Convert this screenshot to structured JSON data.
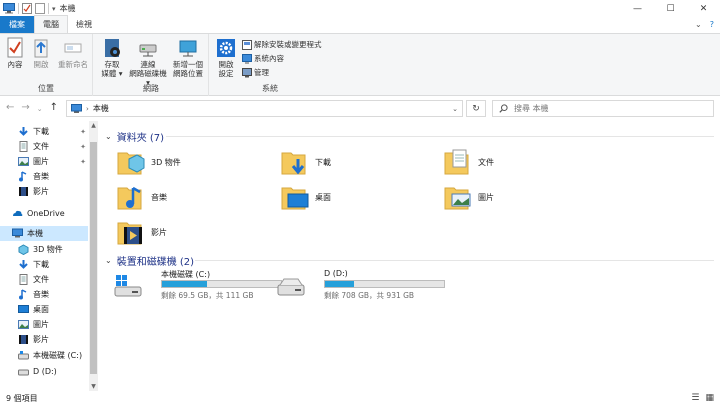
{
  "window": {
    "title": "本機",
    "controls": {
      "minimize": "—",
      "maximize": "☐",
      "close": "✕"
    }
  },
  "ribbon": {
    "tabs": [
      "檔案",
      "電腦",
      "檢視"
    ],
    "active_tab": "電腦",
    "groups": {
      "location": {
        "label": "位置",
        "buttons": [
          "內容",
          "開啟",
          "重新命名"
        ]
      },
      "network": {
        "label": "網路",
        "buttons": [
          "存取\n媒體 ▾",
          "連線\n網路磁碟機 ▾",
          "新增一個\n網路位置"
        ]
      },
      "system": {
        "label": "系統",
        "open_settings": "開啟\n設定",
        "small": [
          "解除安裝或變更程式",
          "系統內容",
          "管理"
        ]
      }
    }
  },
  "address": {
    "path": "本機",
    "search_placeholder": "搜尋 本機"
  },
  "navpane": {
    "items": [
      {
        "label": "下載",
        "icon": "download-icon",
        "pinned": true
      },
      {
        "label": "文件",
        "icon": "document-icon",
        "pinned": true
      },
      {
        "label": "圖片",
        "icon": "picture-icon",
        "pinned": true
      },
      {
        "label": "音樂",
        "icon": "music-icon",
        "pinned": false
      },
      {
        "label": "影片",
        "icon": "video-icon",
        "pinned": false
      },
      {
        "label": "OneDrive",
        "icon": "onedrive-icon",
        "pinned": false
      },
      {
        "label": "本機",
        "icon": "pc-icon",
        "pinned": false,
        "selected": true
      },
      {
        "label": "3D 物件",
        "icon": "3d-objects-icon",
        "pinned": false
      },
      {
        "label": "下載",
        "icon": "download-icon",
        "pinned": false
      },
      {
        "label": "文件",
        "icon": "document-icon",
        "pinned": false
      },
      {
        "label": "音樂",
        "icon": "music-icon",
        "pinned": false
      },
      {
        "label": "桌面",
        "icon": "desktop-icon",
        "pinned": false
      },
      {
        "label": "圖片",
        "icon": "picture-icon",
        "pinned": false
      },
      {
        "label": "影片",
        "icon": "video-icon",
        "pinned": false
      },
      {
        "label": "本機磁碟 (C:)",
        "icon": "drive-c-icon",
        "pinned": false
      },
      {
        "label": "D (D:)",
        "icon": "drive-d-icon",
        "pinned": false
      }
    ]
  },
  "content": {
    "folders_header": "資料夾 (7)",
    "folders": [
      {
        "label": "3D 物件",
        "icon": "3d-objects-folder-icon"
      },
      {
        "label": "下載",
        "icon": "downloads-folder-icon"
      },
      {
        "label": "文件",
        "icon": "documents-folder-icon"
      },
      {
        "label": "音樂",
        "icon": "music-folder-icon"
      },
      {
        "label": "桌面",
        "icon": "desktop-folder-icon"
      },
      {
        "label": "圖片",
        "icon": "pictures-folder-icon"
      },
      {
        "label": "影片",
        "icon": "videos-folder-icon"
      }
    ],
    "drives_header": "裝置和磁碟機 (2)",
    "drives": [
      {
        "name": "本機磁碟 (C:)",
        "free_text": "剩餘 69.5 GB，共 111 GB",
        "used_fraction": 0.374,
        "icon": "windows-drive-icon"
      },
      {
        "name": "D (D:)",
        "free_text": "剩餘 708 GB，共 931 GB",
        "used_fraction": 0.24,
        "icon": "hard-drive-icon"
      }
    ]
  },
  "status": {
    "item_count": "9 個項目"
  },
  "colors": {
    "accent": "#1979ca",
    "selection": "#cce8ff",
    "progress": "#26a0da",
    "section_header": "#1e3287",
    "folder": "#f4c95d"
  }
}
